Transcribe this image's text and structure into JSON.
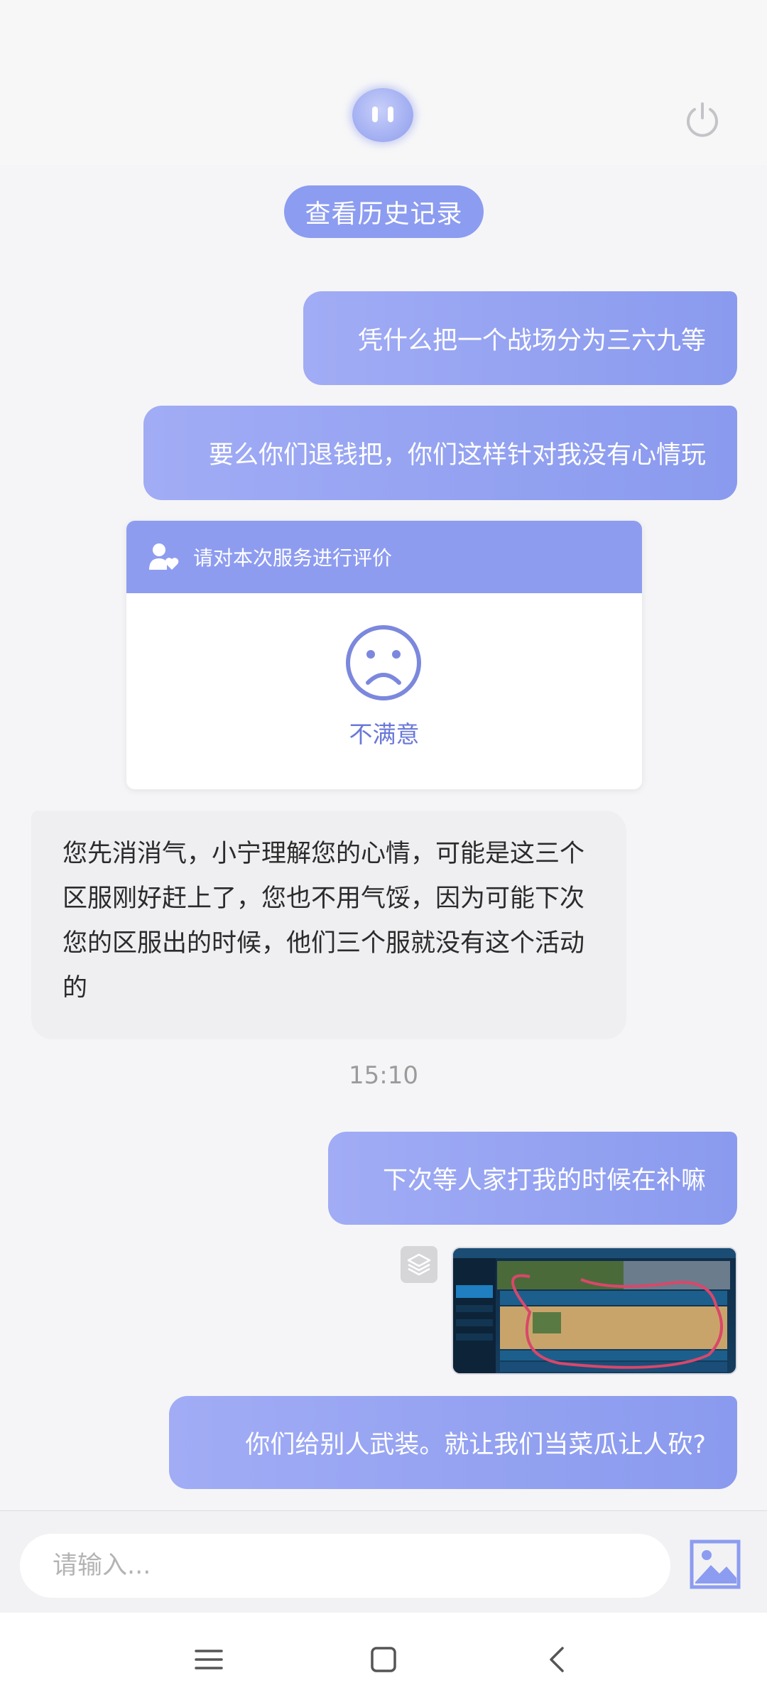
{
  "header": {
    "avatar_icon": "robot-face-icon",
    "power_icon": "power-icon"
  },
  "history_button": "查看历史记录",
  "messages": {
    "out_1": "凭什么把一个战场分为三六九等",
    "out_2": "要么你们退钱把，你们这样针对我没有心情玩",
    "rating": {
      "title": "请对本次服务进行评价",
      "result": "不满意",
      "icon": "sad-face-icon"
    },
    "in_1": "您先消消气，小宁理解您的心情，可能是这三个区服刚好赶上了，您也不用气馁，因为可能下次您的区服出的时候，他们三个服就没有这个活动的",
    "timestamp": "15:10",
    "out_3": "下次等人家打我的时候在补嘛",
    "out_4": "你们给别人武装。就让我们当菜瓜让人砍?"
  },
  "input": {
    "placeholder": "请输入..."
  },
  "colors": {
    "accent": "#8c9cf0",
    "bubble_in": "#efeff2",
    "rating_text": "#6a78d8"
  }
}
